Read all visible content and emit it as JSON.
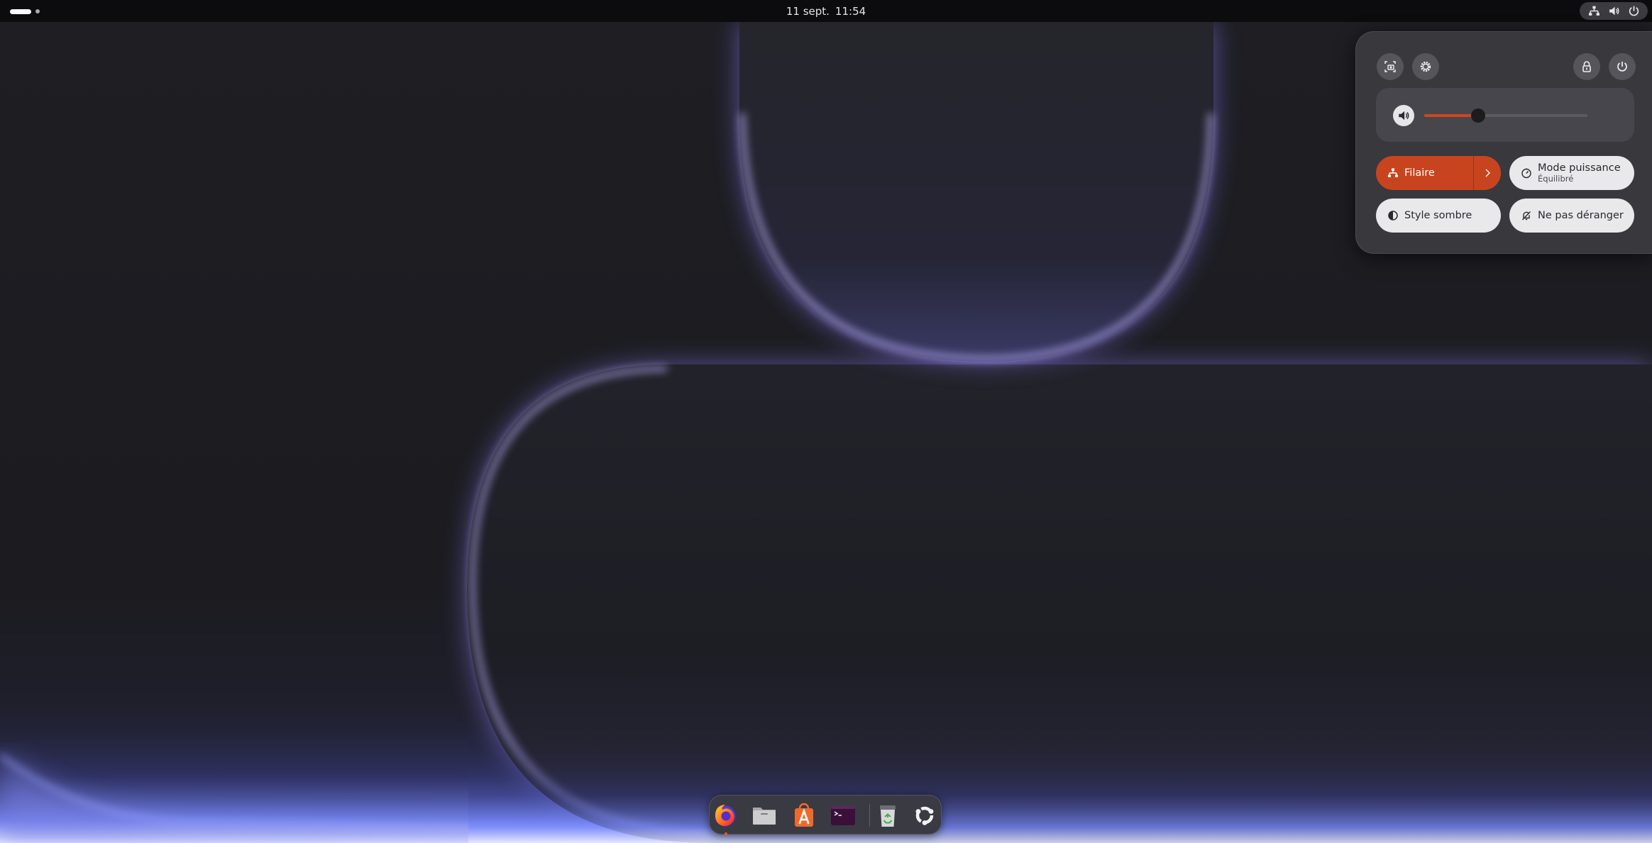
{
  "top_bar": {
    "date": "11 sept.",
    "time": "11:54",
    "activities_icon": "workspace-indicator-icon",
    "tray_icons": [
      "wired-network-icon",
      "speaker-icon",
      "power-icon"
    ]
  },
  "quick_settings": {
    "top_buttons": [
      "screenshot-icon",
      "settings-gear-icon",
      "lock-icon",
      "power-icon"
    ],
    "volume": {
      "icon": "speaker-icon",
      "level": 0.33
    },
    "tiles": {
      "wired": {
        "label": "Filaire",
        "icon": "wired-network-icon",
        "active": true,
        "has_arrow": true
      },
      "power_mode": {
        "label": "Mode puissance",
        "subtitle": "Équilibré",
        "icon": "power-mode-icon"
      },
      "dark_style": {
        "label": "Style sombre",
        "icon": "dark-style-icon"
      },
      "dnd": {
        "label": "Ne pas déranger",
        "icon": "bell-off-icon"
      }
    }
  },
  "dock": {
    "apps": [
      {
        "name": "firefox",
        "icon": "firefox-icon",
        "running": true
      },
      {
        "name": "files",
        "icon": "files-folder-icon",
        "running": false
      },
      {
        "name": "app-center",
        "icon": "app-center-icon",
        "running": false
      },
      {
        "name": "terminal",
        "icon": "terminal-icon",
        "running": false
      },
      {
        "name": "trash",
        "icon": "trash-icon",
        "running": false
      },
      {
        "name": "show-apps",
        "icon": "ubuntu-apps-grid-icon",
        "running": false
      }
    ]
  },
  "colors": {
    "accent": "#c8441f",
    "panel_bg": "#38383d",
    "top_bar_bg": "#0c0c0e",
    "wallpaper_glow": "#8b7cff"
  }
}
